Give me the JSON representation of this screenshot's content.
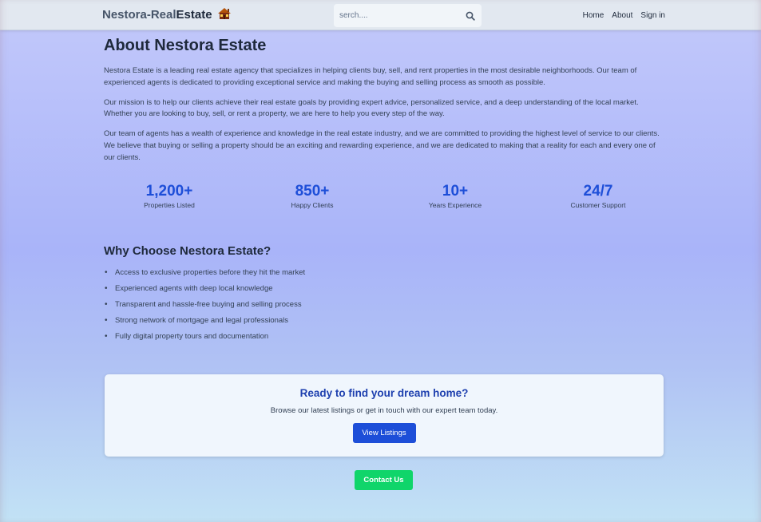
{
  "header": {
    "brand_part1": "Nestora-Real",
    "brand_part2": "Estate",
    "brand_icon": "house-icon",
    "search_placeholder": "serch....",
    "search_icon": "search-icon",
    "nav": [
      "Home",
      "About",
      "Sign in"
    ]
  },
  "about": {
    "title": "About Nestora Estate",
    "paragraphs": [
      "Nestora Estate is a leading real estate agency that specializes in helping clients buy, sell, and rent properties in the most desirable neighborhoods. Our team of experienced agents is dedicated to providing exceptional service and making the buying and selling process as smooth as possible.",
      "Our mission is to help our clients achieve their real estate goals by providing expert advice, personalized service, and a deep understanding of the local market. Whether you are looking to buy, sell, or rent a property, we are here to help you every step of the way.",
      "Our team of agents has a wealth of experience and knowledge in the real estate industry, and we are committed to providing the highest level of service to our clients. We believe that buying or selling a property should be an exciting and rewarding experience, and we are dedicated to making that a reality for each and every one of our clients."
    ]
  },
  "stats": [
    {
      "value": "1,200+",
      "label": "Properties Listed"
    },
    {
      "value": "850+",
      "label": "Happy Clients"
    },
    {
      "value": "10+",
      "label": "Years Experience"
    },
    {
      "value": "24/7",
      "label": "Customer Support"
    }
  ],
  "why": {
    "title": "Why Choose Nestora Estate?",
    "items": [
      "Access to exclusive properties before they hit the market",
      "Experienced agents with deep local knowledge",
      "Transparent and hassle-free buying and selling process",
      "Strong network of mortgage and legal professionals",
      "Fully digital property tours and documentation"
    ]
  },
  "cta": {
    "title": "Ready to find your dream home?",
    "text": "Browse our latest listings or get in touch with our expert team today.",
    "button": "View Listings"
  },
  "contact_button": "Contact Us",
  "colors": {
    "accent": "#1d4ed8",
    "contact": "#10d56a",
    "header_bg": "#e2e8f0"
  }
}
